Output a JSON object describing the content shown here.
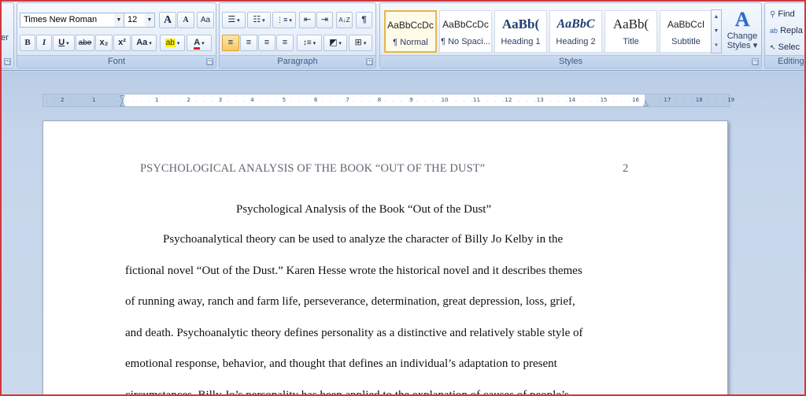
{
  "font_group": {
    "label": "Font",
    "font_name": "Times New Roman",
    "font_size": "12",
    "grow": "A",
    "shrink": "A",
    "clear": "Aa",
    "bold": "B",
    "italic": "I",
    "underline": "U",
    "strike": "abe",
    "subscript": "x₂",
    "superscript": "x²",
    "change_case": "Aa",
    "highlight": "ab",
    "font_color": "A",
    "partial_left_label": "er"
  },
  "paragraph_group": {
    "label": "Paragraph",
    "bullets": "☰",
    "numbering": "☷",
    "multilevel": "⋮≡",
    "decrease_indent": "⇤",
    "increase_indent": "⇥",
    "sort": "A↓Z",
    "show_marks": "¶",
    "align_left": "≡",
    "center": "≡",
    "align_right": "≡",
    "justify": "≡",
    "line_spacing": "↕≡",
    "shading": "◩",
    "borders": "⊞"
  },
  "styles_group": {
    "label": "Styles",
    "tiles": [
      {
        "sample": "AaBbCcDc",
        "name": "¶ Normal",
        "selected": true
      },
      {
        "sample": "AaBbCcDc",
        "name": "¶ No Spaci...",
        "selected": false
      },
      {
        "sample": "AaBb(",
        "name": "Heading 1",
        "selected": false
      },
      {
        "sample": "AaBbC",
        "name": "Heading 2",
        "selected": false
      },
      {
        "sample": "AaBb(",
        "name": "Title",
        "selected": false
      },
      {
        "sample": "AaBbCcI",
        "name": "Subtitle",
        "selected": false
      }
    ],
    "change_styles": "Change Styles ▾",
    "change_styles_line1": "Change",
    "change_styles_line2": "Styles ▾"
  },
  "editing_group": {
    "label": "Editing",
    "find": "Find",
    "replace": "Repla",
    "select": "Selec"
  },
  "ruler": {
    "ticks": [
      "2",
      "1",
      "1",
      "2",
      "3",
      "4",
      "5",
      "6",
      "7",
      "8",
      "9",
      "10",
      "11",
      "12",
      "13",
      "14",
      "15",
      "16",
      "17",
      "18",
      "19"
    ]
  },
  "document": {
    "running_head": "PSYCHOLOGICAL ANALYSIS OF THE BOOK “OUT OF THE DUST”",
    "page_number": "2",
    "title": "Psychological Analysis of the Book “Out of the Dust”",
    "lines": [
      "Psychoanalytical theory can be used to analyze the character of Billy Jo Kelby in the",
      "fictional novel “Out of the Dust.” Karen Hesse wrote the historical novel and it describes themes",
      "of running away, ranch and farm life, perseverance, determination, great depression, loss, grief,",
      "and death. Psychoanalytic theory defines personality as  a distinctive and relatively stable style of",
      "emotional response, behavior, and thought that defines an individual’s adaptation to present",
      "circumstances. Billy Jo’s personality has been applied to the explanation of causes of people’s"
    ]
  },
  "colors": {
    "ribbon_bg": "#dde8f5",
    "workspace_bg": "#c6d6ea",
    "selected_style": "#e8b54a",
    "frame": "#d5343b"
  }
}
